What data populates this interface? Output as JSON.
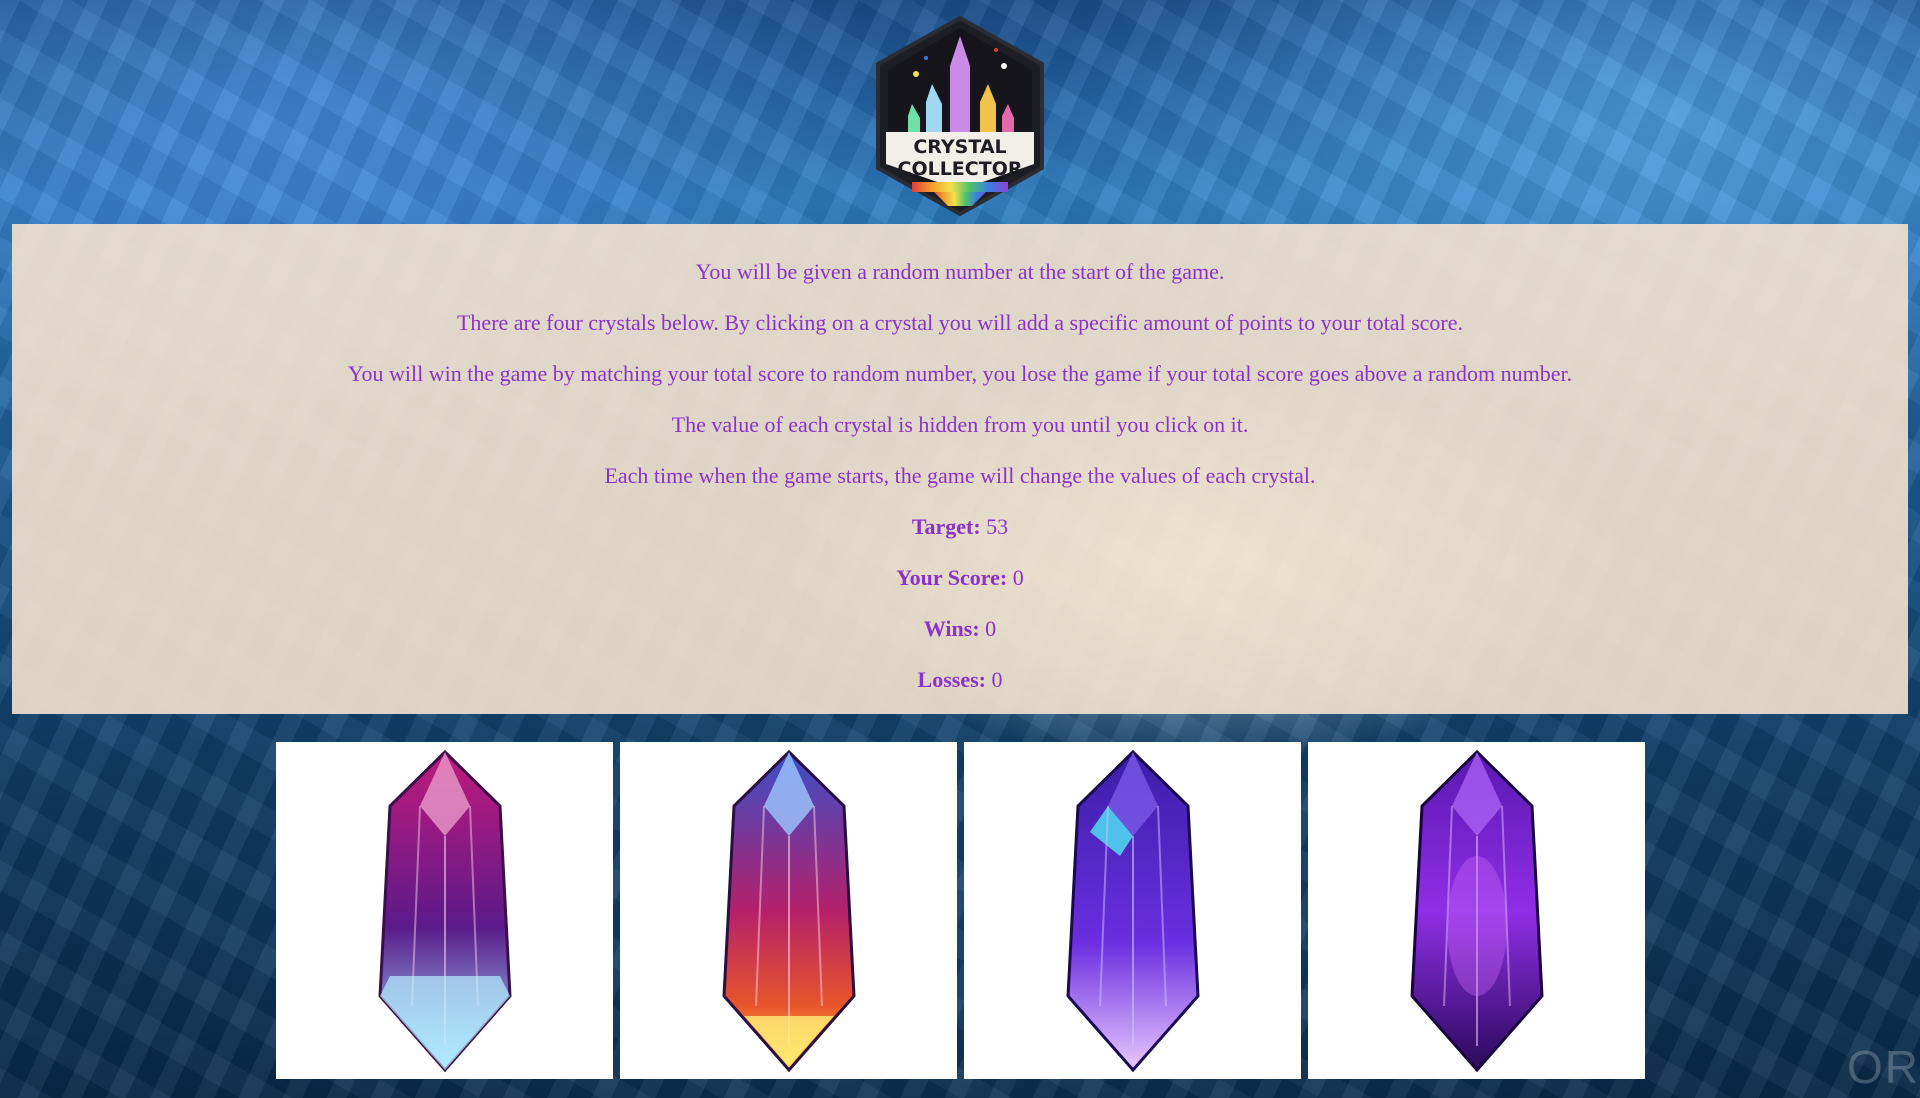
{
  "logo": {
    "line1": "CRYSTAL",
    "line2": "COLLECTOR",
    "icon": "crystal-collector-badge"
  },
  "instructions": [
    "You will be given a random number at the start of the game.",
    "There are four crystals below. By clicking on a crystal you will add a specific amount of points to your total score.",
    "You will win the game by matching your total score to random number, you lose the game if your total score goes above a random number.",
    "The value of each crystal is hidden from you until you click on it.",
    "Each time when the game starts, the game will change the values of each crystal."
  ],
  "stats": {
    "target_label": "Target:",
    "target_value": "53",
    "score_label": "Your Score:",
    "score_value": "0",
    "wins_label": "Wins:",
    "wins_value": "0",
    "losses_label": "Losses:",
    "losses_value": "0"
  },
  "crystals": [
    {
      "name": "pink-blue-crystal",
      "colors": [
        "#c21a7a",
        "#5b1a8a",
        "#9fe6ff"
      ]
    },
    {
      "name": "blue-fire-crystal",
      "colors": [
        "#3a4fc8",
        "#b4206a",
        "#ffd94a"
      ]
    },
    {
      "name": "indigo-crystal",
      "colors": [
        "#3a1fa8",
        "#6a2ee0",
        "#e8c8ff"
      ]
    },
    {
      "name": "violet-crystal",
      "colors": [
        "#5a18b0",
        "#8f2ee6",
        "#2a0a5a"
      ]
    }
  ],
  "watermark": "OR",
  "colors": {
    "text": "#8a33c8",
    "panel": "#f4e2cd"
  }
}
